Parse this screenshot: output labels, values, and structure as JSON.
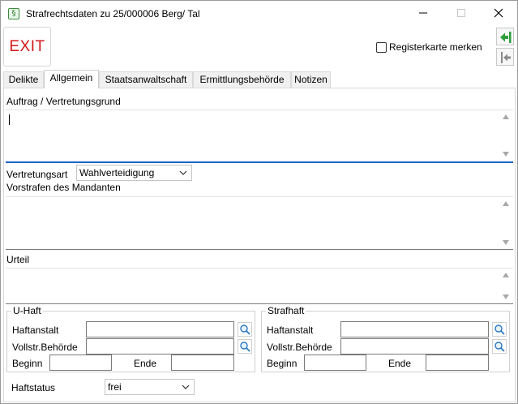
{
  "window": {
    "title": "Strafrechtsdaten zu 25/000006 Berg/ Tal",
    "app_icon_glyph": "§",
    "minimize_glyph": "—",
    "maximize_glyph": "☐",
    "close_glyph": "✕"
  },
  "toolbar": {
    "exit_label": "EXIT",
    "remember_tab_label": "Registerkarte merken",
    "remember_tab_checked": false,
    "accent_green": "#2e9e3a"
  },
  "tabs": [
    {
      "label": "Delikte",
      "active": false
    },
    {
      "label": "Allgemein",
      "active": true
    },
    {
      "label": "Staatsanwaltschaft",
      "active": false
    },
    {
      "label": "Ermittlungsbehörde",
      "active": false
    },
    {
      "label": "Notizen",
      "active": false
    }
  ],
  "general": {
    "order_label": "Auftrag / Vertretungsgrund",
    "order_value": "",
    "representation_label": "Vertretungsart",
    "representation_value": "Wahlverteidigung",
    "priors_label": "Vorstrafen des Mandanten",
    "priors_value": "",
    "verdict_label": "Urteil",
    "verdict_value": ""
  },
  "u_haft": {
    "title": "U-Haft",
    "facility_label": "Haftanstalt",
    "enforcement_label": "Vollstr.Behörde",
    "begin_label": "Beginn",
    "end_label": "Ende"
  },
  "strafhaft": {
    "title": "Strafhaft",
    "facility_label": "Haftanstalt",
    "enforcement_label": "Vollstr.Behörde",
    "begin_label": "Beginn",
    "end_label": "Ende"
  },
  "status": {
    "label": "Haftstatus",
    "value": "frei"
  },
  "colors": {
    "exit_red": "#d21a1a",
    "focus_blue": "#1f64c8"
  }
}
